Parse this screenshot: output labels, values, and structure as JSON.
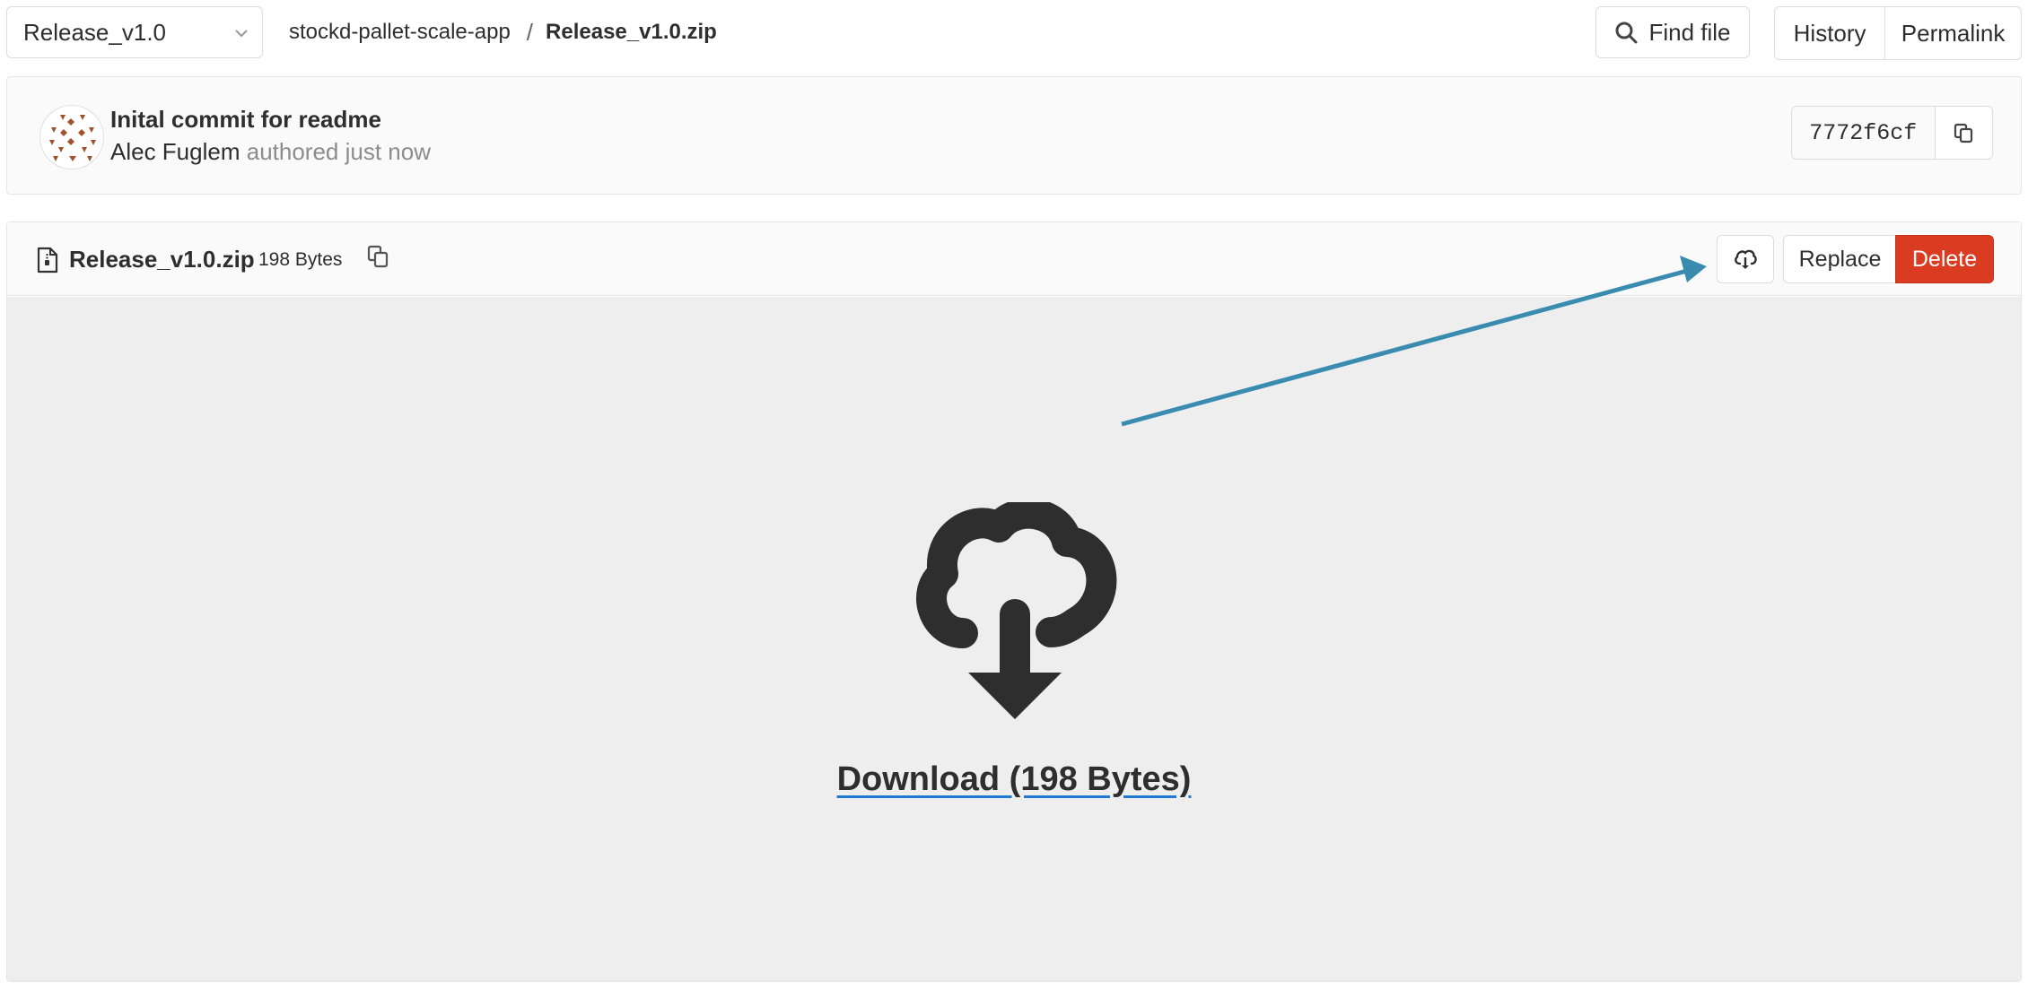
{
  "header": {
    "branch": "Release_v1.0",
    "breadcrumb": {
      "project": "stockd-pallet-scale-app",
      "separator": "/",
      "file": "Release_v1.0.zip"
    },
    "find_file_label": "Find file",
    "history_label": "History",
    "permalink_label": "Permalink"
  },
  "commit": {
    "title": "Inital commit for readme",
    "author": "Alec Fuglem",
    "meta_suffix": "authored just now",
    "sha": "7772f6cf"
  },
  "file": {
    "name": "Release_v1.0.zip",
    "size": "198 Bytes",
    "replace_label": "Replace",
    "delete_label": "Delete",
    "download_label": "Download (198 Bytes)"
  },
  "colors": {
    "delete": "#db3b21",
    "annotation_arrow": "#3a8bb0",
    "link_underline": "#1f78d1",
    "avatar": "#a0522d"
  },
  "icons": {
    "branch_dropdown": "chevron-down-icon",
    "find_file": "search-icon",
    "copy_sha": "copy-icon",
    "file_type": "file-zip-icon",
    "copy_path": "copy-icon",
    "download_small": "cloud-download-icon",
    "download_large": "cloud-download-icon"
  }
}
